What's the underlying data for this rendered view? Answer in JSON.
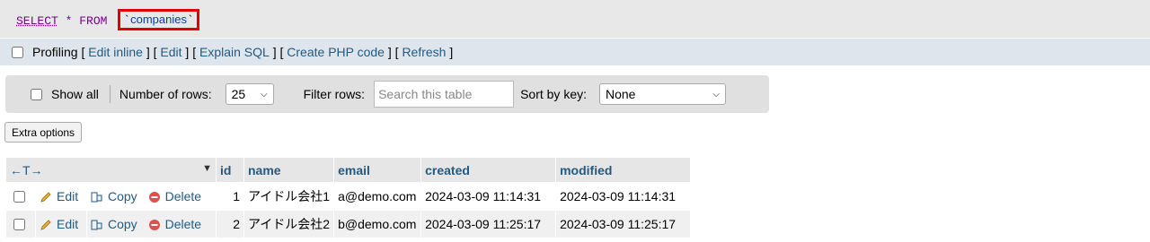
{
  "query": {
    "select": "SELECT",
    "star": "*",
    "from": "FROM",
    "table": "companies"
  },
  "profiling": {
    "label": "Profiling",
    "links": [
      "Edit inline",
      "Edit",
      "Explain SQL",
      "Create PHP code",
      "Refresh"
    ]
  },
  "navigation": {
    "show_all": "Show all",
    "rows_label": "Number of rows:",
    "rows_value": "25",
    "filter_label": "Filter rows:",
    "filter_placeholder": "Search this table",
    "sort_label": "Sort by key:",
    "sort_value": "None"
  },
  "extra_options": "Extra options",
  "table": {
    "arrows": "←T→",
    "columns": [
      "id",
      "name",
      "email",
      "created",
      "modified"
    ],
    "actions": {
      "edit": "Edit",
      "copy": "Copy",
      "delete": "Delete"
    },
    "rows": [
      {
        "id": "1",
        "name": "アイドル会社1",
        "email": "a@demo.com",
        "created": "2024-03-09 11:14:31",
        "modified": "2024-03-09 11:14:31"
      },
      {
        "id": "2",
        "name": "アイドル会社2",
        "email": "b@demo.com",
        "created": "2024-03-09 11:25:17",
        "modified": "2024-03-09 11:25:17"
      }
    ]
  },
  "colors": {
    "link": "#235a81",
    "keyword": "#770088",
    "highlight": "#e00000",
    "delete": "#d9534f"
  }
}
